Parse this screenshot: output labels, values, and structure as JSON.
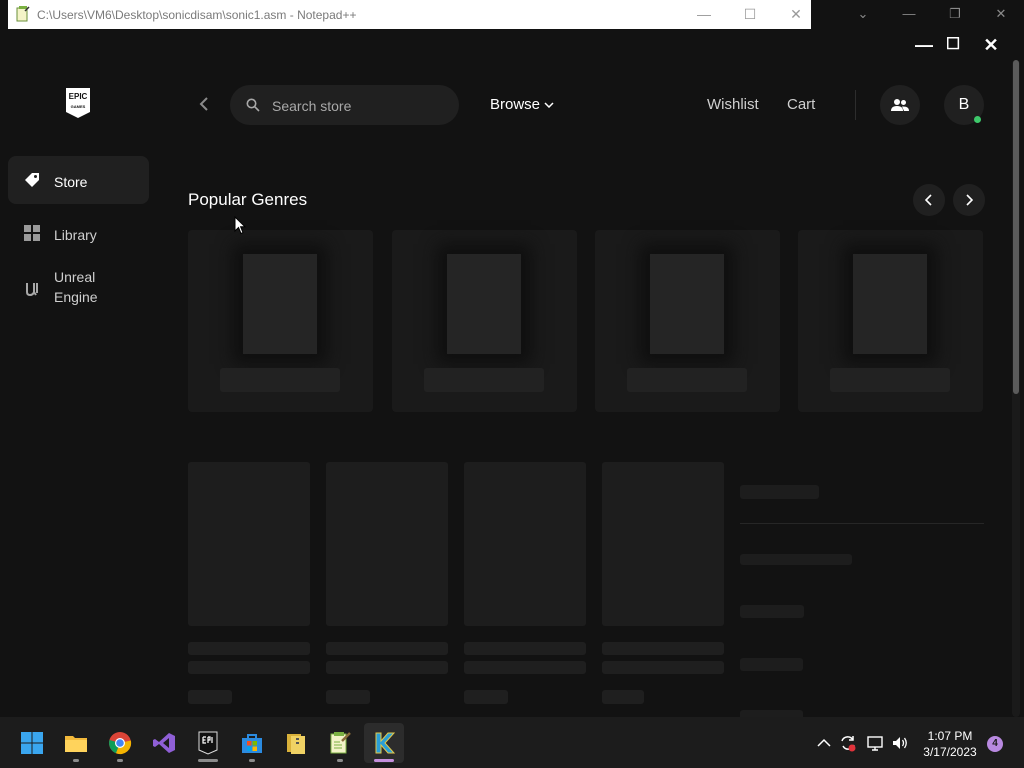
{
  "notepad_window": {
    "title": "C:\\Users\\VM6\\Desktop\\sonicdisam\\sonic1.asm - Notepad++",
    "minimize": "—",
    "maximize": "☐",
    "close": "✕"
  },
  "outer_window_controls": {
    "chevron": "⌄",
    "minimize": "—",
    "restore": "❐",
    "close": "✕"
  },
  "epic": {
    "window_controls": {
      "minimize": "—",
      "maximize": "☐",
      "close": "✕"
    },
    "logo_text_top": "EPIC",
    "logo_text_bottom": "GAMES",
    "sidebar": {
      "items": [
        {
          "label": "Store",
          "icon": "tag-icon",
          "active": true
        },
        {
          "label": "Library",
          "icon": "grid-icon",
          "active": false
        },
        {
          "label": "Unreal\nEngine",
          "icon": "unreal-icon",
          "active": false
        }
      ]
    },
    "topbar": {
      "search_placeholder": "Search store",
      "browse_label": "Browse",
      "wishlist_label": "Wishlist",
      "cart_label": "Cart",
      "avatar_initial": "B",
      "status_color": "#3ec96b"
    },
    "section": {
      "title": "Popular Genres"
    }
  },
  "taskbar": {
    "apps": [
      "start-icon",
      "file-explorer-icon",
      "chrome-icon",
      "visual-studio-icon",
      "epic-games-icon",
      "microsoft-store-icon",
      "archive-icon",
      "notepad-plus-plus-icon",
      "k-app-icon"
    ],
    "clock_time": "1:07 PM",
    "clock_date": "3/17/2023",
    "notification_count": "4"
  },
  "colors": {
    "accent_purple": "#b889e0",
    "online_green": "#3ec96b",
    "background": "#121212"
  }
}
